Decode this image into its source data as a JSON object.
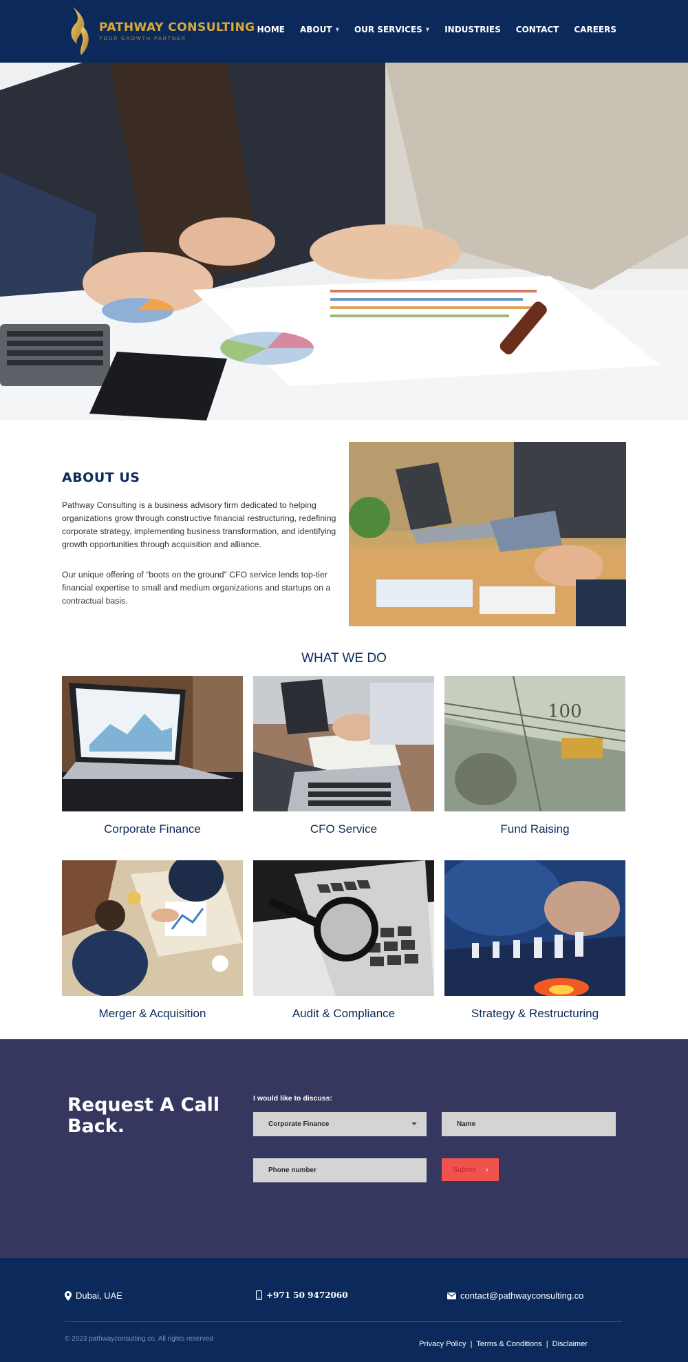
{
  "header": {
    "brand_name": "PATHWAY CONSULTING",
    "brand_tagline": "YOUR GROWTH PARTNER",
    "nav": [
      {
        "label": "HOME",
        "has_dropdown": false
      },
      {
        "label": "ABOUT",
        "has_dropdown": true
      },
      {
        "label": "OUR SERVICES",
        "has_dropdown": true
      },
      {
        "label": "INDUSTRIES",
        "has_dropdown": false
      },
      {
        "label": "CONTACT",
        "has_dropdown": false
      },
      {
        "label": "CAREERS",
        "has_dropdown": false
      }
    ],
    "colors": {
      "bg": "#0b2a5b",
      "brand": "#d6a93c"
    }
  },
  "hero": {
    "image": "business-meeting-charts-photo"
  },
  "about": {
    "title": "ABOUT US",
    "p1": "Pathway Consulting is a business advisory firm dedicated to helping organizations grow through constructive financial restructuring, redefining corporate strategy, implementing business transformation, and identifying growth opportunities through acquisition and alliance.",
    "p2": "Our unique offering of “boots on the ground” CFO service lends top-tier financial expertise to small and medium organizations and startups on a contractual basis.",
    "image": "laptop-tablet-meeting-photo"
  },
  "what_we_do": {
    "title": "WHAT WE DO",
    "services": [
      {
        "label": "Corporate Finance",
        "image": "laptop-dashboard-photo"
      },
      {
        "label": "CFO Service",
        "image": "laptop-documents-photo"
      },
      {
        "label": "Fund Raising",
        "image": "dollar-bills-photo"
      },
      {
        "label": "Merger & Acquisition",
        "image": "handshake-table-photo"
      },
      {
        "label": "Audit & Compliance",
        "image": "magnifier-keyboard-photo"
      },
      {
        "label": "Strategy & Restructuring",
        "image": "chess-strategy-photo"
      }
    ]
  },
  "callback": {
    "title": "Request A Call Back.",
    "discuss_label": "I would like to discuss:",
    "select_value": "Corporate Finance",
    "name_placeholder": "Name",
    "phone_placeholder": "Phone number",
    "submit_label": "Submit",
    "colors": {
      "bg": "#36375e",
      "submit": "#f0534b"
    }
  },
  "footer": {
    "location": "Dubai, UAE",
    "phone": "+971 50 9472060",
    "email": "contact@pathwayconsulting.co",
    "copyright": "© 2023 pathwayconsulting.co. All rights reserved",
    "links": [
      "Privacy Policy",
      "Terms & Conditions",
      "Disclaimer"
    ]
  }
}
